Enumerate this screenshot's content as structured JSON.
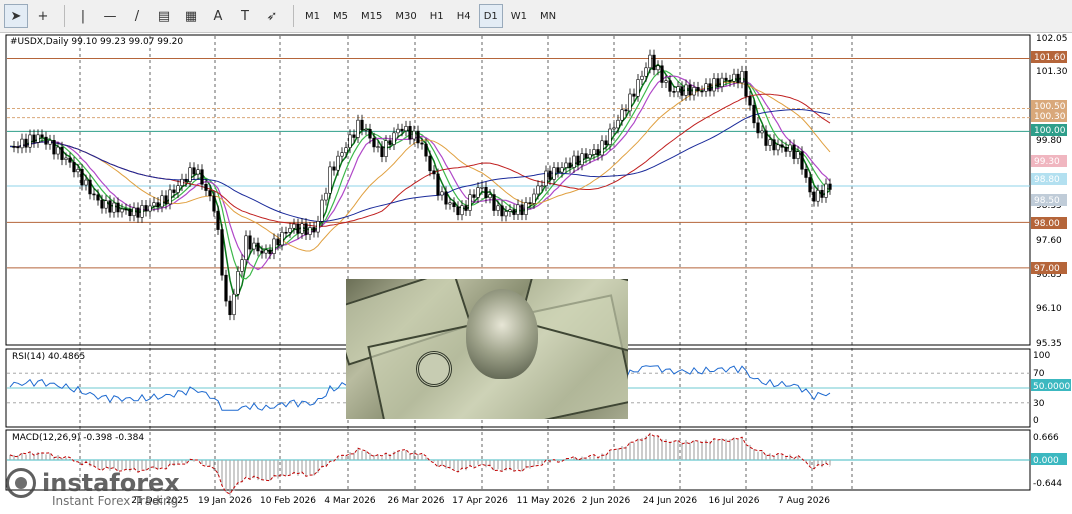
{
  "toolbar": {
    "tools": [
      {
        "name": "cursor",
        "glyph": "➤"
      },
      {
        "name": "crosshair",
        "glyph": "+"
      },
      {
        "name": "vertical-line",
        "glyph": "|"
      },
      {
        "name": "horizontal-line",
        "glyph": "—"
      },
      {
        "name": "trend-line",
        "glyph": "/"
      },
      {
        "name": "channels",
        "glyph": "▤"
      },
      {
        "name": "fibonacci",
        "glyph": "▦"
      },
      {
        "name": "text",
        "glyph": "A"
      },
      {
        "name": "text-label",
        "glyph": "T"
      },
      {
        "name": "arrows",
        "glyph": "➶"
      }
    ],
    "timeframes": [
      "M1",
      "M5",
      "M15",
      "M30",
      "H1",
      "H4",
      "D1",
      "W1",
      "MN"
    ],
    "active_timeframe": "D1"
  },
  "header": {
    "title": "#USDX,Daily 99.10 99.23 99.07 99.20"
  },
  "price_axis": {
    "labels": [
      "102.05",
      "101.30",
      "99.80",
      "98.35",
      "97.60",
      "96.85",
      "96.10",
      "95.35"
    ],
    "tags": [
      {
        "label": "101.60",
        "color": "#b5653a"
      },
      {
        "label": "100.50",
        "color": "#d9a87a"
      },
      {
        "label": "100.30",
        "color": "#d9a87a"
      },
      {
        "label": "100.00",
        "color": "#2e9e8a"
      },
      {
        "label": "99.30",
        "color": "#f0b6c0"
      },
      {
        "label": "98.80",
        "color": "#b3e0f0"
      },
      {
        "label": "98.50",
        "color": "#c0ccd8"
      },
      {
        "label": "98.00",
        "color": "#b5653a"
      },
      {
        "label": "97.00",
        "color": "#b5653a"
      }
    ]
  },
  "rsi": {
    "title": "RSI(14) 40.4865",
    "axis": [
      "100",
      "70",
      "50.0000",
      "30",
      "0"
    ],
    "tag_color": "#3cb8c0"
  },
  "macd": {
    "title": "MACD(12,26,9) -0.398 -0.384",
    "axis": [
      "0.666",
      "0.000",
      "-0.644"
    ],
    "tag_color": "#3cb8c0"
  },
  "time_axis": [
    "19 Jan 2026",
    "10 Feb 2026",
    "4 Mar 2026",
    "26 Mar 2026",
    "17 Apr 2026",
    "11 May 2026",
    "2 Jun 2026",
    "24 Jun 2026",
    "16 Jul 2026",
    "7 Aug 2026"
  ],
  "time_axis_partial": [
    "21 Dec 2025"
  ],
  "logo": {
    "name": "instaforex",
    "tagline": "Instant Forex Trading"
  }
}
